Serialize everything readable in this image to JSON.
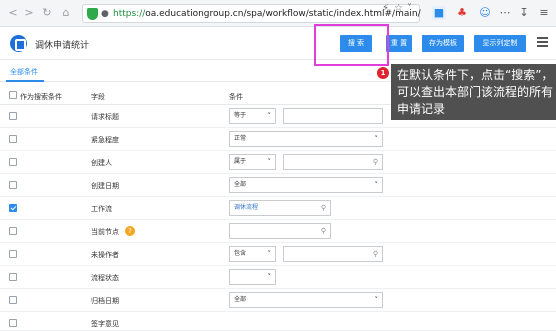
{
  "browser": {
    "url_scheme": "https://",
    "url_rest": "oa.educationgroup.cn/spa/workflow/static/index.html#/main/"
  },
  "app": {
    "title": "调休申请统计",
    "buttons": {
      "search": "搜 索",
      "reset": "重 置",
      "save_template": "存为模板",
      "show_columns": "显示列定制"
    }
  },
  "tabs": [
    {
      "label": "全部条件"
    }
  ],
  "table": {
    "headers": {
      "as_condition": "作为搜索条件",
      "field": "字段",
      "condition": "条件"
    },
    "rows": [
      {
        "field": "请求标题",
        "checked": false,
        "select": "等于"
      },
      {
        "field": "紧急程度",
        "checked": false,
        "select": "正常"
      },
      {
        "field": "创建人",
        "checked": false,
        "select": "属于"
      },
      {
        "field": "创建日期",
        "checked": false,
        "select": "全部"
      },
      {
        "field": "工作流",
        "checked": true,
        "value": "调休流程"
      },
      {
        "field": "当前节点",
        "checked": false,
        "help": "?"
      },
      {
        "field": "未操作者",
        "checked": false,
        "select": "包含"
      },
      {
        "field": "流程状态",
        "checked": false
      },
      {
        "field": "归档日期",
        "checked": false,
        "select": "全部"
      },
      {
        "field": "签字意见",
        "checked": false
      }
    ]
  },
  "callout": {
    "badge": "1",
    "text": "在默认条件下，点击“搜索”，可以查出本部门该流程的所有申请记录"
  },
  "colors": {
    "accent": "#2d8ceb",
    "highlight": "#e13ddb",
    "badge": "#e0242f",
    "callout_bg": "#505050"
  }
}
